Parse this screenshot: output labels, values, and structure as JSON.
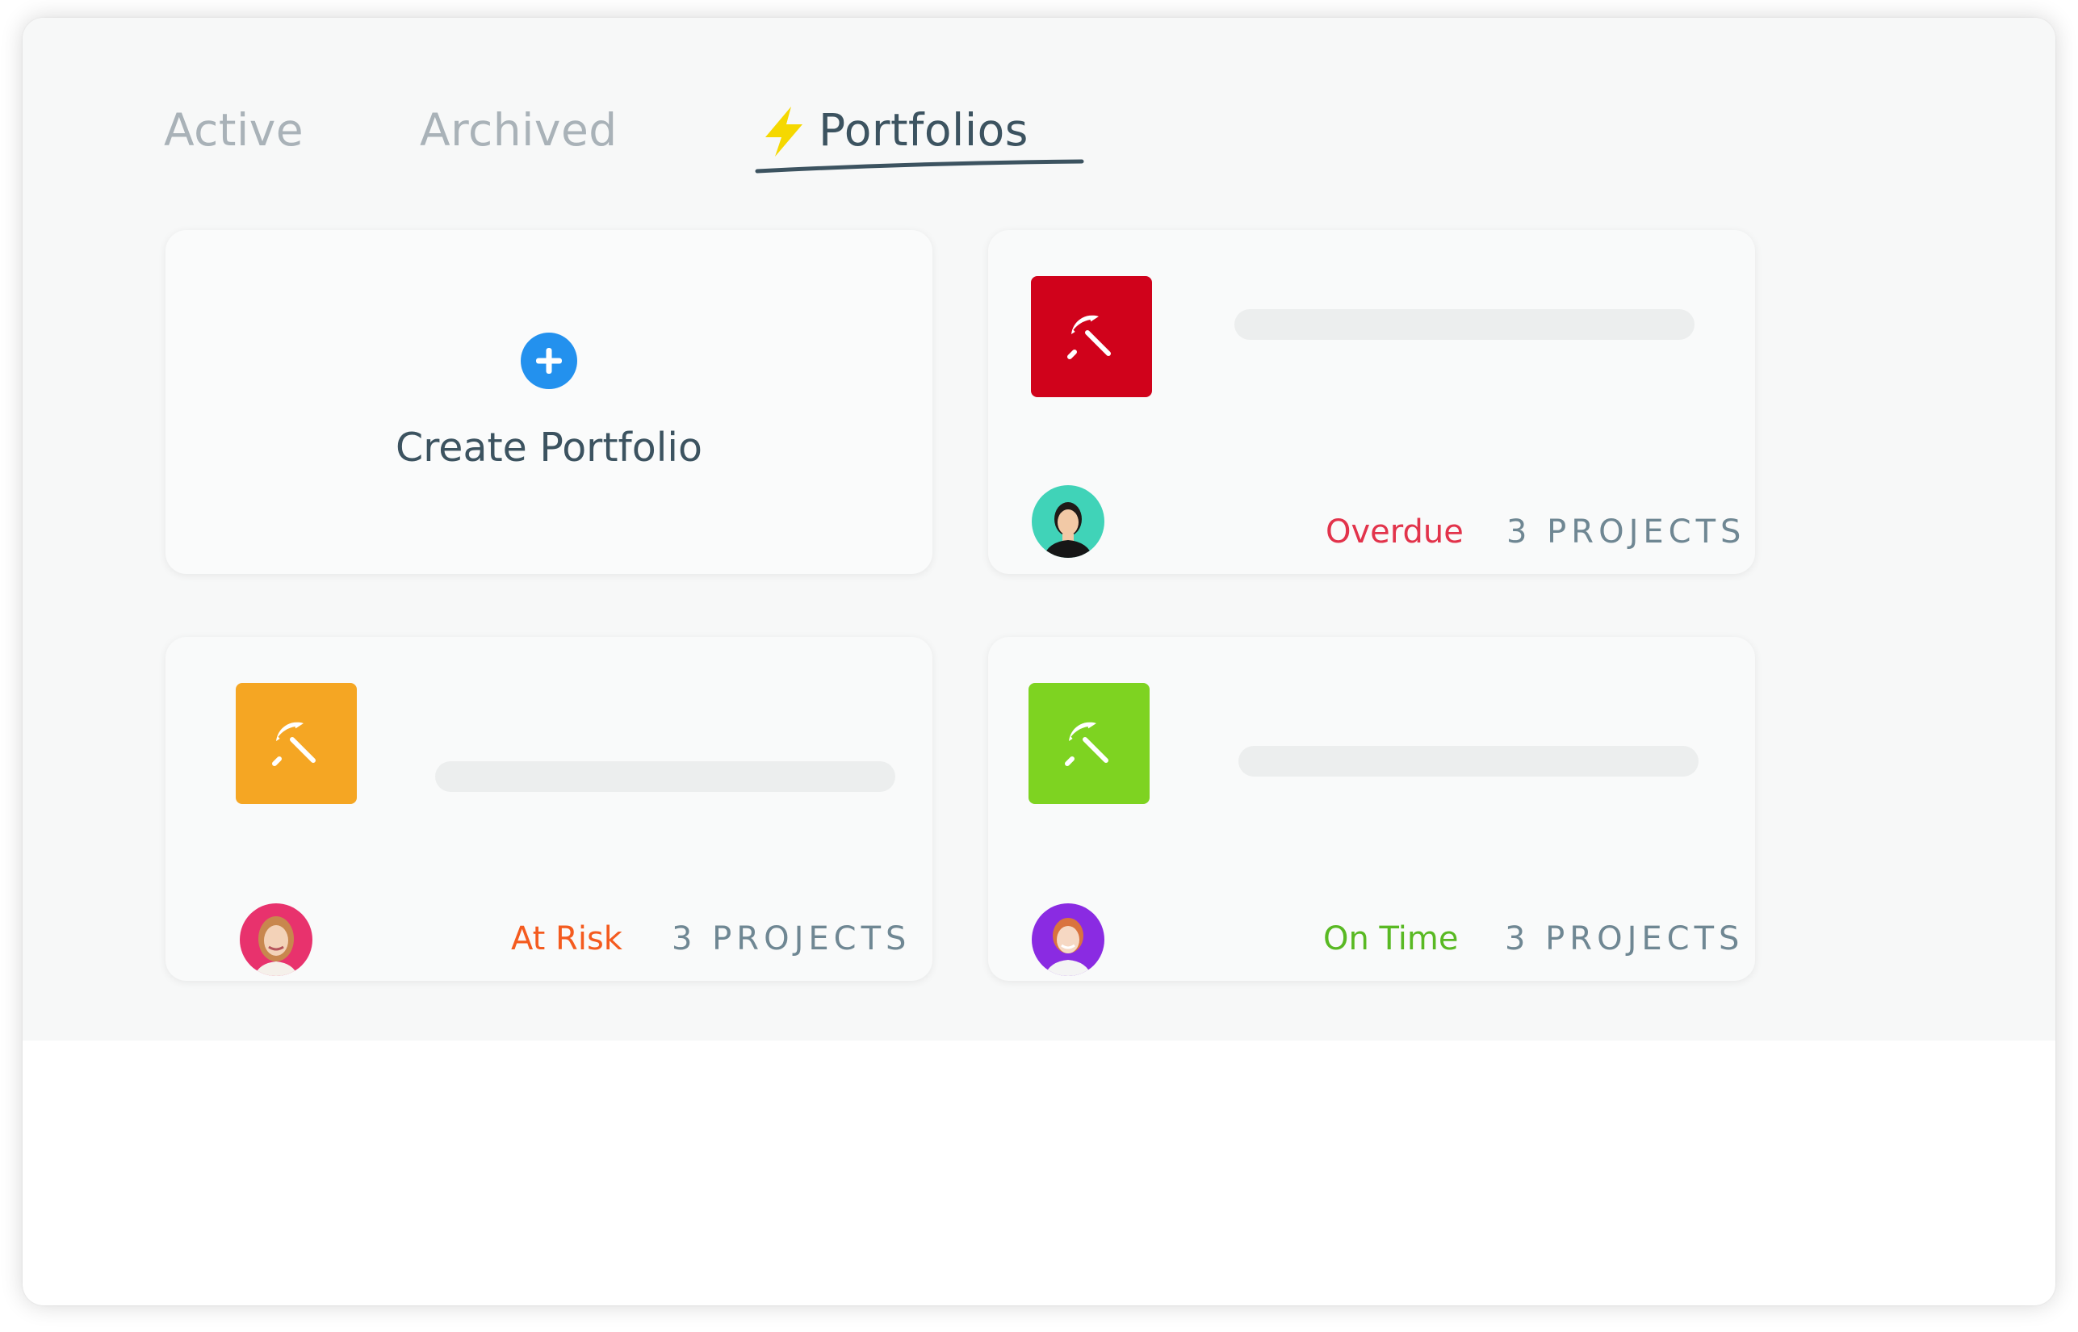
{
  "tabs": {
    "active": "Active",
    "archived": "Archived",
    "portfolios": "Portfolios"
  },
  "colors": {
    "tab_inactive": "#a9b2b8",
    "tab_selected": "#3c5360",
    "bolt": "#f5d800",
    "create_plus": "#2391ee",
    "overdue": "#e2334b",
    "at_risk": "#f45b1f",
    "on_time": "#59b923",
    "projects_count": "#6f8793"
  },
  "create_card": {
    "label": "Create Portfolio",
    "icon": "plus-circle-icon"
  },
  "portfolios": [
    {
      "icon": "beach-umbrella-icon",
      "icon_bg": "#d0021b",
      "avatar_bg": "#40d3b8",
      "status": "Overdue",
      "status_color": "#e2334b",
      "count": "3 PROJECTS"
    },
    {
      "icon": "beach-umbrella-icon",
      "icon_bg": "#f5a623",
      "avatar_bg": "#e8326d",
      "status": "At Risk",
      "status_color": "#f45b1f",
      "count": "3 PROJECTS"
    },
    {
      "icon": "beach-umbrella-icon",
      "icon_bg": "#7ed321",
      "avatar_bg": "#8a2be2",
      "status": "On Time",
      "status_color": "#59b923",
      "count": "3 PROJECTS"
    }
  ]
}
